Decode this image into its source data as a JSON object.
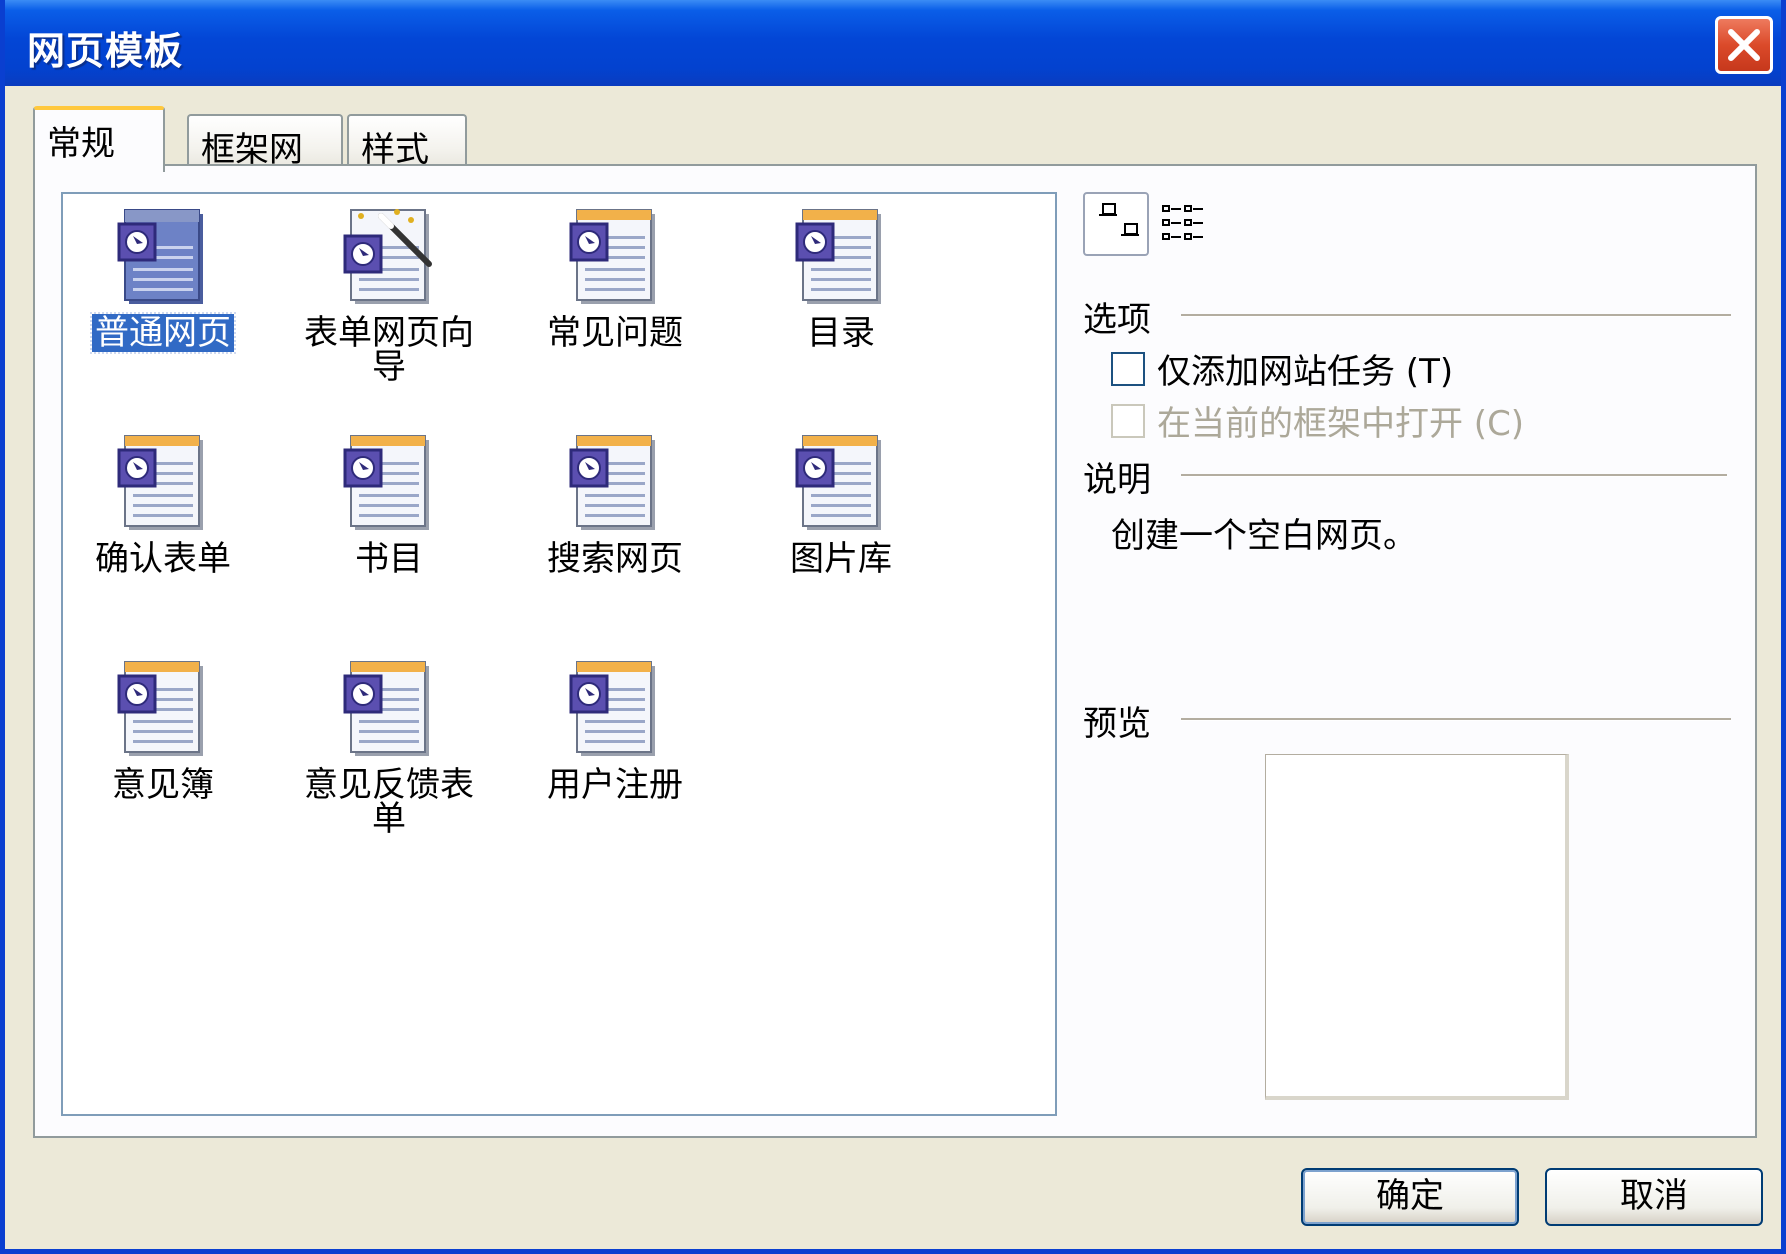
{
  "window": {
    "title": "网页模板"
  },
  "tabs": [
    {
      "label": "常规",
      "active": true
    },
    {
      "label": "框架网页",
      "active": false
    },
    {
      "label": "样式表",
      "active": false
    }
  ],
  "templates": [
    {
      "label": "普通网页",
      "selected": true,
      "icon": "normal-page-icon"
    },
    {
      "label": "表单网页向导",
      "selected": false,
      "icon": "form-wizard-icon"
    },
    {
      "label": "常见问题",
      "selected": false,
      "icon": "page-template-icon"
    },
    {
      "label": "目录",
      "selected": false,
      "icon": "page-template-icon"
    },
    {
      "label": "确认表单",
      "selected": false,
      "icon": "page-template-icon"
    },
    {
      "label": "书目",
      "selected": false,
      "icon": "page-template-icon"
    },
    {
      "label": "搜索网页",
      "selected": false,
      "icon": "page-template-icon"
    },
    {
      "label": "图片库",
      "selected": false,
      "icon": "page-template-icon"
    },
    {
      "label": "意见簿",
      "selected": false,
      "icon": "page-template-icon"
    },
    {
      "label": "意见反馈表单",
      "selected": false,
      "icon": "page-template-icon"
    },
    {
      "label": "用户注册",
      "selected": false,
      "icon": "page-template-icon"
    }
  ],
  "view_buttons": [
    {
      "icon": "large-icons-view-icon",
      "active": true
    },
    {
      "icon": "details-view-icon",
      "active": false
    }
  ],
  "options": {
    "heading": "选项",
    "add_web_task": {
      "label": "仅添加网站任务 (T)",
      "checked": false,
      "enabled": true
    },
    "open_in_frame": {
      "label": "在当前的框架中打开 (C)",
      "checked": false,
      "enabled": false
    }
  },
  "description": {
    "heading": "说明",
    "text": "创建一个空白网页。"
  },
  "preview": {
    "heading": "预览"
  },
  "buttons": {
    "ok": "确定",
    "cancel": "取消"
  },
  "colors": {
    "titlebar": "#0346d6",
    "selection": "#316ac5",
    "dialog_bg": "#ece9d8",
    "tab_highlight": "#ffc83d"
  }
}
